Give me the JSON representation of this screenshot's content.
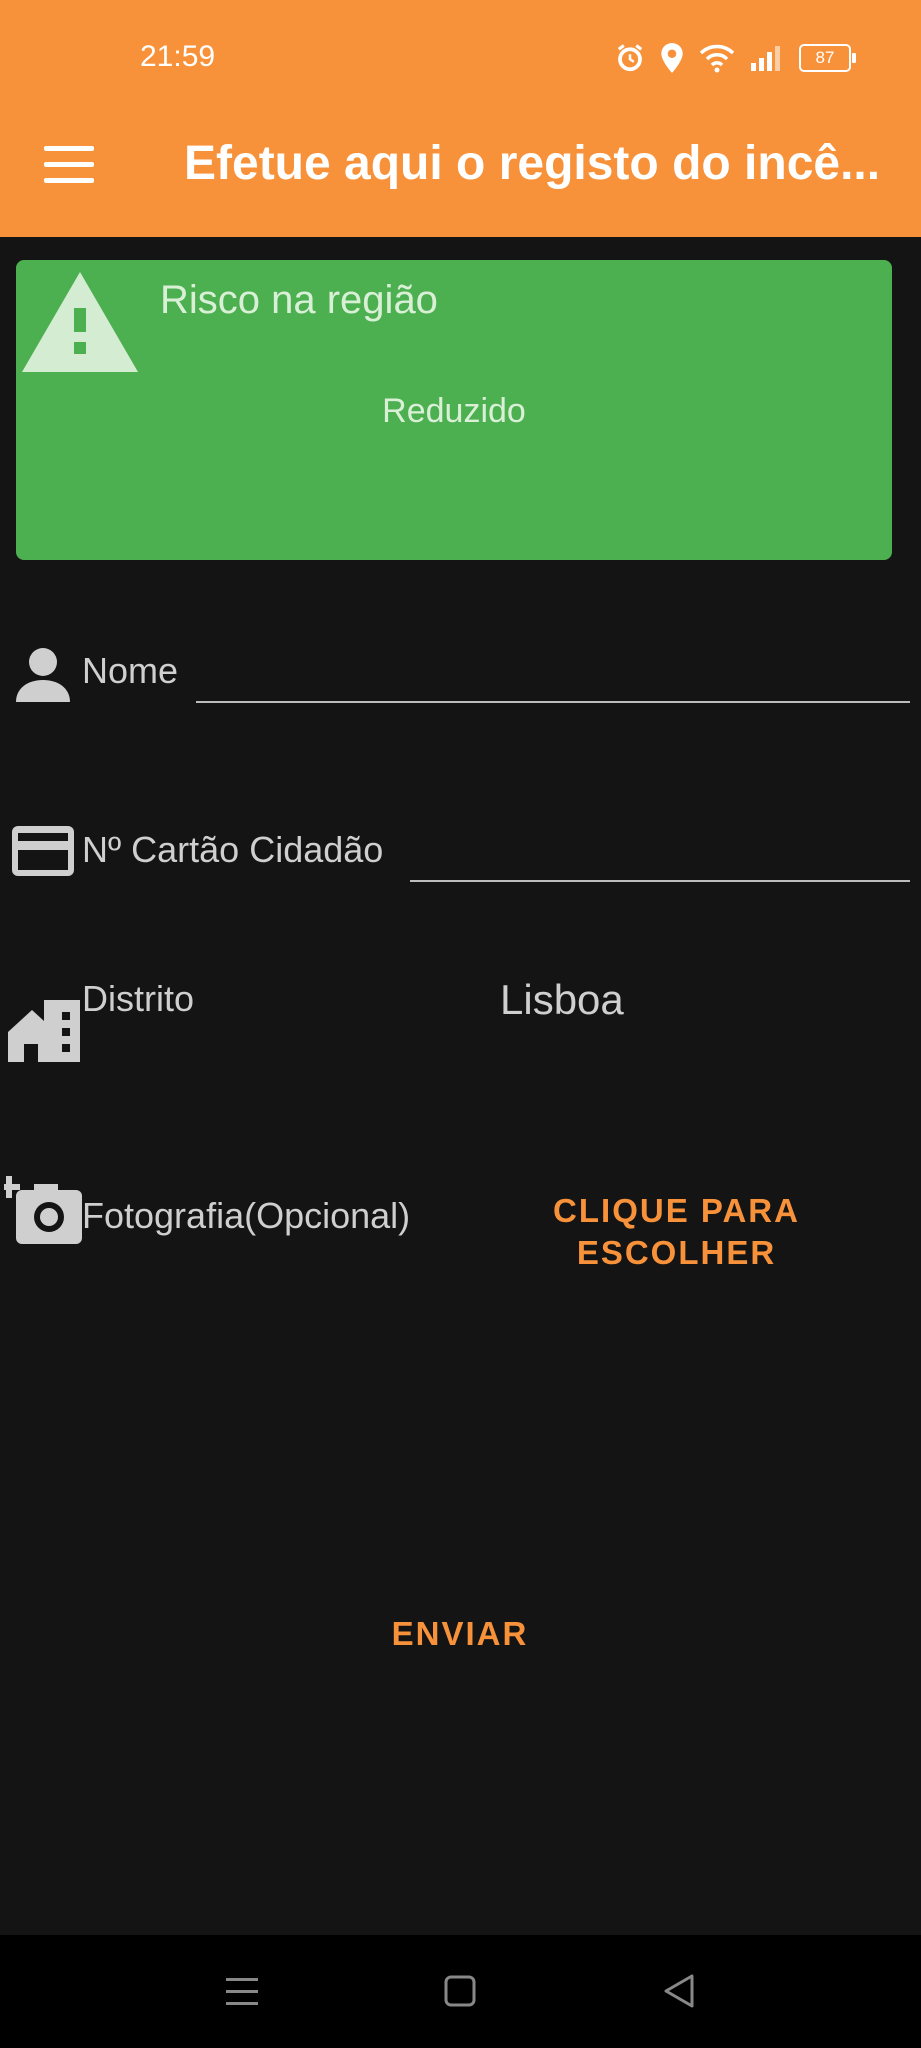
{
  "status_bar": {
    "time": "21:59",
    "battery": "87"
  },
  "app_bar": {
    "title": "Efetue aqui o registo do incê..."
  },
  "risk_card": {
    "label": "Risco na região",
    "value": "Reduzido",
    "color": "#4CAF50"
  },
  "form": {
    "name_label": "Nome",
    "name_value": "",
    "cc_label": "Nº Cartão Cidadão",
    "cc_value": "",
    "district_label": "Distrito",
    "district_value": "Lisboa",
    "photo_label": "Fotografia(Opcional)",
    "photo_button_line1": "CLIQUE PARA",
    "photo_button_line2": "ESCOLHER",
    "send_button": "ENVIAR"
  },
  "theme": {
    "accent": "#F8923A",
    "background": "#141414"
  },
  "icons": {
    "menu": "menu-icon",
    "alarm": "alarm-icon",
    "location": "location-icon",
    "wifi": "wifi-icon",
    "signal": "signal-icon",
    "warning": "warning-icon",
    "person": "person-icon",
    "card": "credit-card-icon",
    "building": "building-icon",
    "camera": "add-photo-icon"
  }
}
